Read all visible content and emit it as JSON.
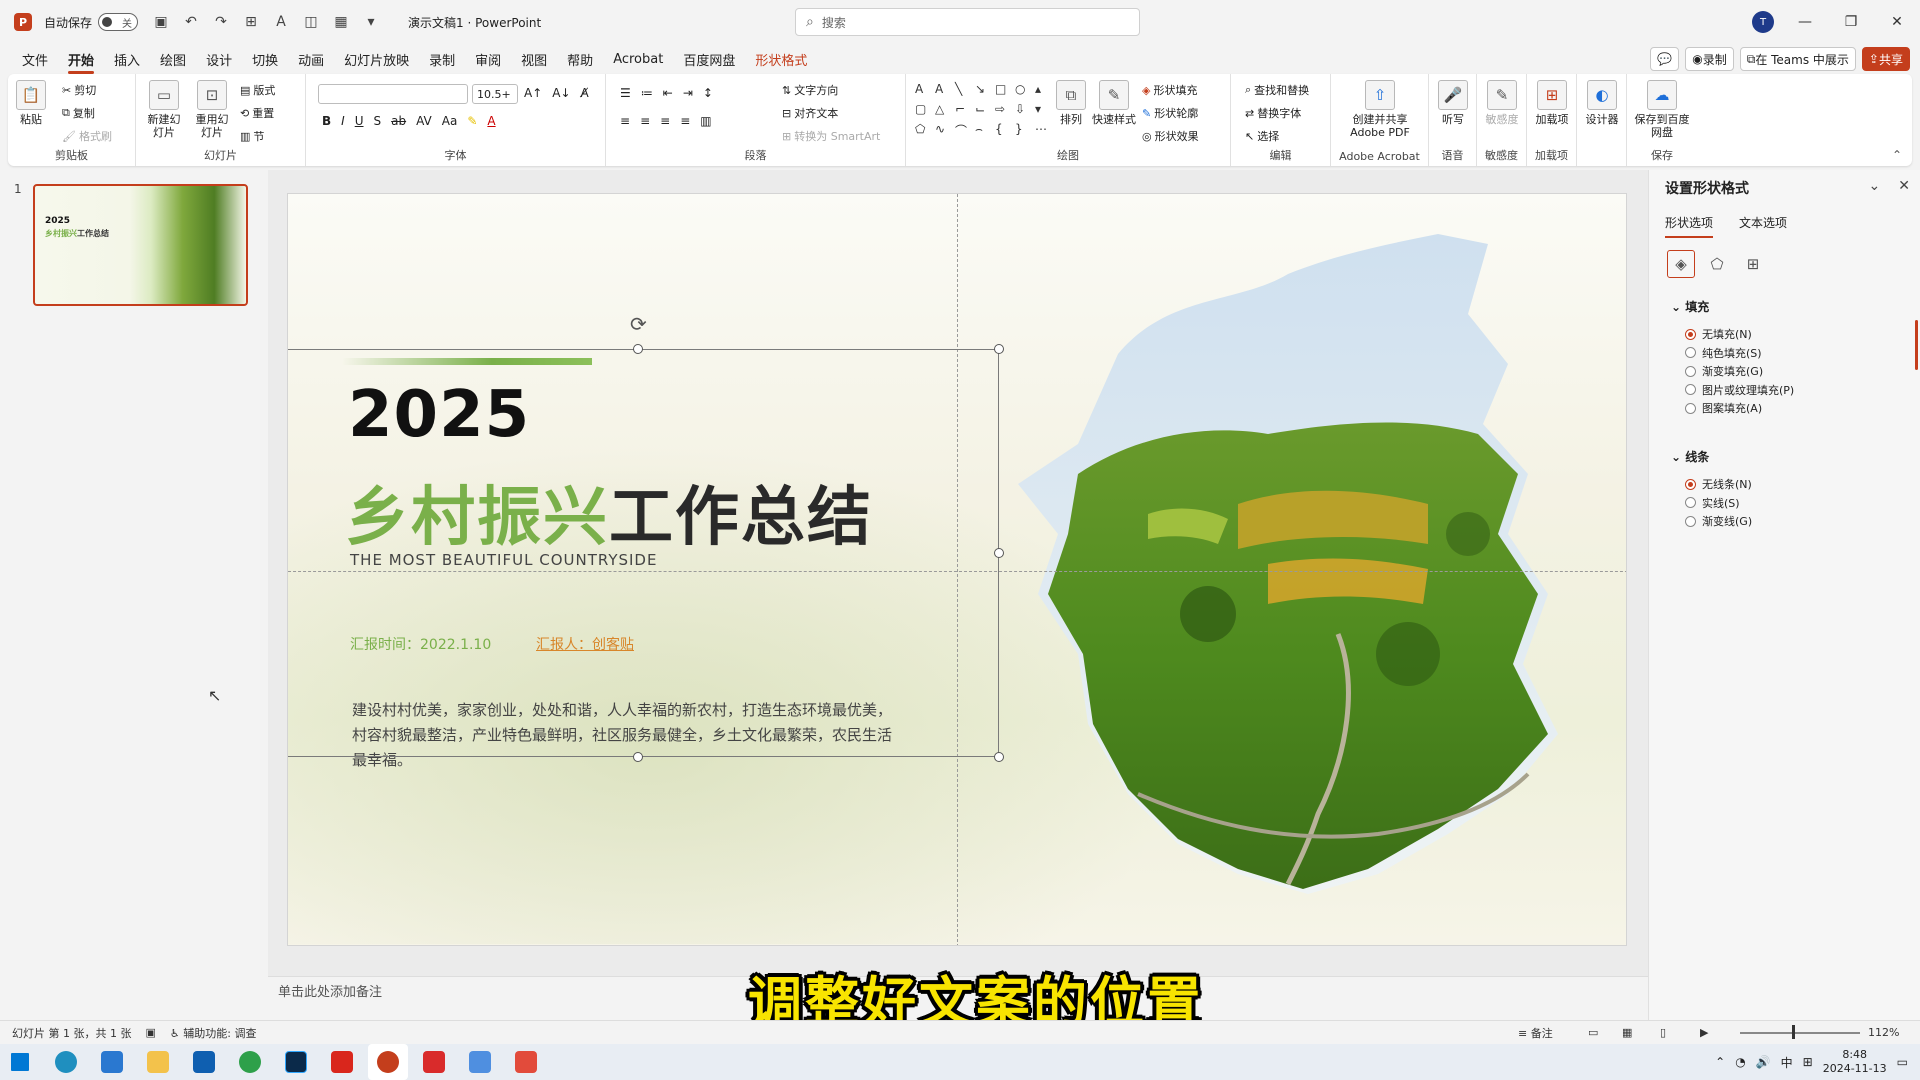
{
  "app": {
    "logo_letter": "P",
    "autosave_label": "自动保存",
    "autosave_state": "关",
    "doc_title": "演示文稿1",
    "app_name": "PowerPoint",
    "search_placeholder": "搜索",
    "avatar_initial": "T",
    "accent_color": "#c43e1c"
  },
  "menu": {
    "items": [
      "文件",
      "开始",
      "插入",
      "绘图",
      "设计",
      "切换",
      "动画",
      "幻灯片放映",
      "录制",
      "审阅",
      "视图",
      "帮助",
      "Acrobat",
      "百度网盘",
      "形状格式"
    ],
    "active": "开始",
    "right": {
      "record": "录制",
      "teams": "在 Teams 中展示",
      "share": "共享"
    }
  },
  "ribbon": {
    "clipboard": {
      "paste": "粘贴",
      "cut": "剪切",
      "copy": "复制",
      "format_painter": "格式刷",
      "label": "剪贴板"
    },
    "slides": {
      "new_slide": "新建幻灯片",
      "reuse": "重用幻灯片",
      "layout": "版式",
      "reset": "重置",
      "section": "节",
      "label": "幻灯片"
    },
    "font": {
      "size": "10.5+",
      "label": "字体"
    },
    "paragraph": {
      "text_direction": "文字方向",
      "align_text": "对齐文本",
      "smartart": "转换为 SmartArt",
      "label": "段落"
    },
    "drawing": {
      "arrange": "排列",
      "quick_styles": "快速样式",
      "shape_fill": "形状填充",
      "shape_outline": "形状轮廓",
      "shape_effects": "形状效果",
      "label": "绘图"
    },
    "editing": {
      "find_replace": "查找和替换",
      "replace_font": "替换字体",
      "select": "选择",
      "label": "编辑"
    },
    "acrobat": {
      "create_share": "创建并共享 Adobe PDF",
      "label": "Adobe Acrobat"
    },
    "voice": {
      "dictate": "听写",
      "label": "语音"
    },
    "sensitivity": {
      "btn": "敏感度",
      "label": "敏感度"
    },
    "addins": {
      "btn": "加载项",
      "label": "加载项"
    },
    "designer": {
      "btn": "设计器"
    },
    "save": {
      "btn": "保存到百度网盘",
      "label": "保存"
    }
  },
  "thumbnails": {
    "number": "1",
    "year": "2025",
    "green": "乡村振兴",
    "rest": "工作总结"
  },
  "slide": {
    "year": "2025",
    "headline_green": "乡村振兴",
    "headline_dark": "工作总结",
    "subtitle": "THE MOST BEAUTIFUL COUNTRYSIDE",
    "report_time": "汇报时间：2022.1.10",
    "reporter": "汇报人：创客贴",
    "body": "建设村村优美，家家创业，处处和谐，人人幸福的新农村，打造生态环境最优美，村容村貌最整洁，产业特色最鲜明，社区服务最健全，乡土文化最繁荣，农民生活最幸福。"
  },
  "notes_placeholder": "单击此处添加备注",
  "caption": "调整好文案的位置",
  "format_pane": {
    "title": "设置形状格式",
    "tabs": [
      "形状选项",
      "文本选项"
    ],
    "fill_section": "填充",
    "fill_options": [
      "无填充(N)",
      "纯色填充(S)",
      "渐变填充(G)",
      "图片或纹理填充(P)",
      "图案填充(A)"
    ],
    "fill_selected": 0,
    "line_section": "线条",
    "line_options": [
      "无线条(N)",
      "实线(S)",
      "渐变线(G)"
    ],
    "line_selected": 0
  },
  "status": {
    "slide_info": "幻灯片 第 1 张，共 1 张",
    "accessibility": "辅助功能: 调查",
    "notes": "备注",
    "zoom": "112%"
  },
  "taskbar": {
    "time": "8:48",
    "date": "2024-11-13",
    "ime": "中"
  }
}
